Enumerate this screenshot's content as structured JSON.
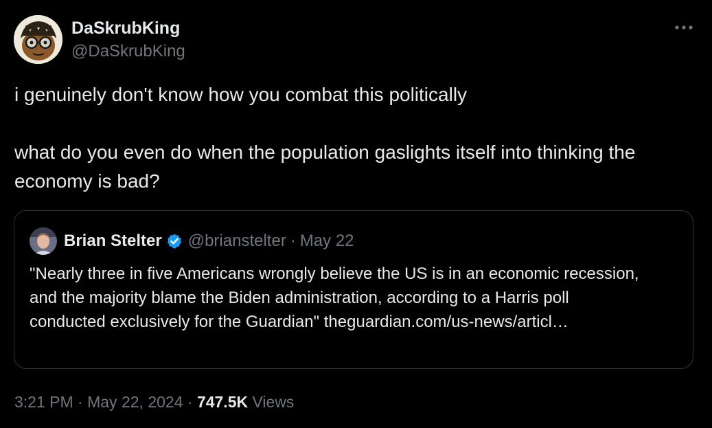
{
  "author": {
    "display_name": "DaSkrubKing",
    "handle": "@DaSkrubKing"
  },
  "more_icon": "more-horizontal-icon",
  "tweet": {
    "line1": "i genuinely don't know how you combat this politically",
    "line2": "what do you even do when the population gaslights itself into thinking the economy is bad?"
  },
  "quote": {
    "display_name": "Brian Stelter",
    "verified_icon": "verified-badge-icon",
    "handle": "@brianstelter",
    "separator": "·",
    "date": "May 22",
    "text": "\"Nearly three in five Americans wrongly believe the US is in an economic recession, and the majority blame the Biden administration, according to a Harris poll conducted exclusively for the Guardian\" theguardian.com/us-news/articl…"
  },
  "meta": {
    "time": "3:21 PM",
    "sep1": "·",
    "date": "May 22, 2024",
    "sep2": "·",
    "views_count": "747.5K",
    "views_label": "Views"
  },
  "colors": {
    "background": "#000000",
    "text_primary": "#e7e9ea",
    "text_secondary": "#71767b",
    "border": "#2f3336",
    "verified_blue": "#1d9bf0"
  }
}
